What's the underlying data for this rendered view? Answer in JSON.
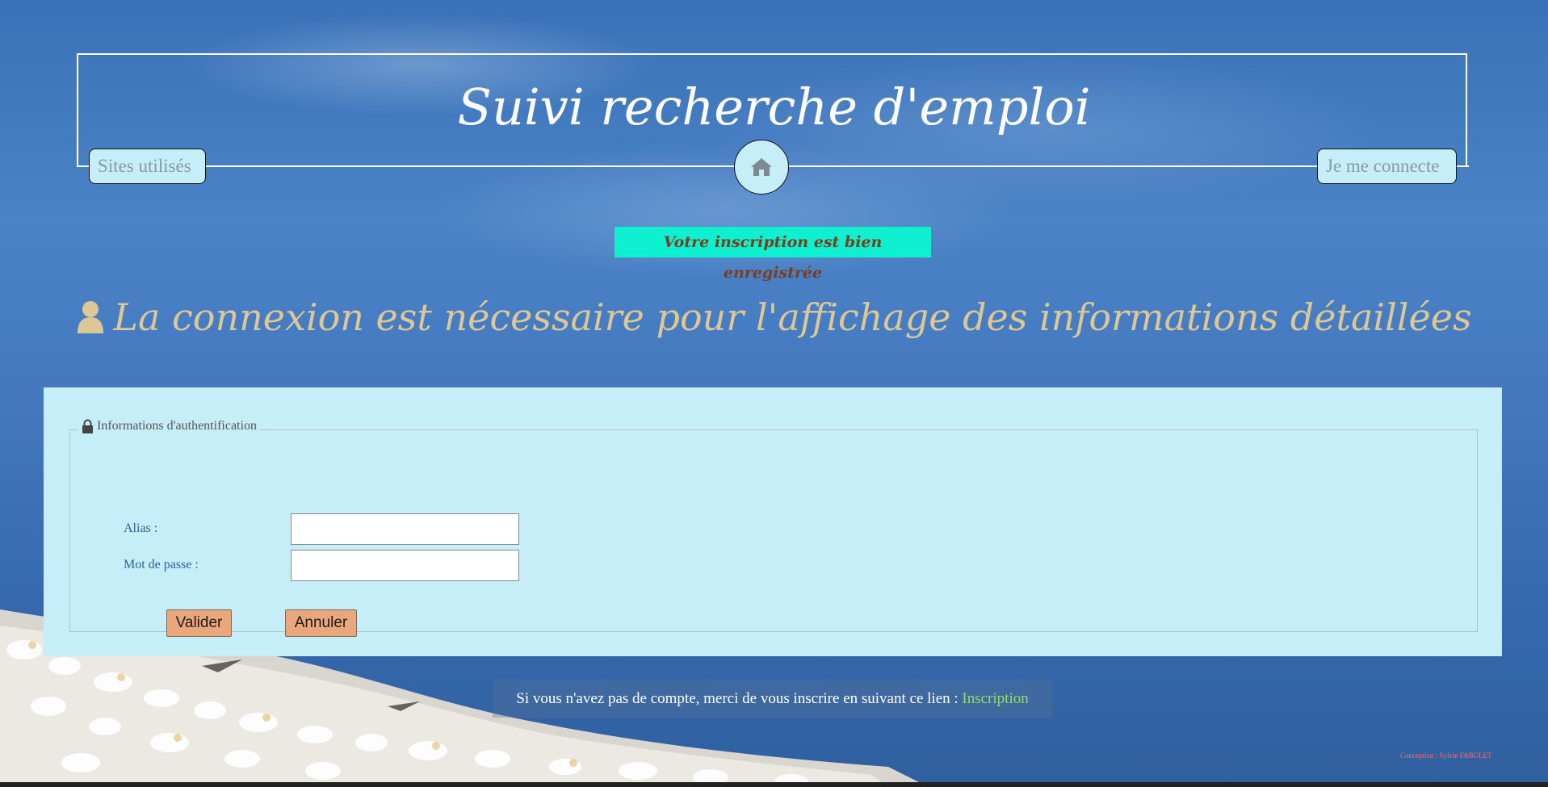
{
  "header": {
    "title": "Suivi recherche d'emploi",
    "nav_sites_label": "Sites utilisés",
    "nav_connect_label": "Je me connecte",
    "home_icon": "home-icon"
  },
  "notice": {
    "success_message": "Votre inscription est bien enregistrée"
  },
  "login_heading": {
    "icon": "user-icon",
    "text": "La connexion est nécessaire pour l'affichage des informations détaillées"
  },
  "auth_form": {
    "legend_icon": "lock-icon",
    "legend": "Informations d'authentification",
    "alias_label": "Alias :",
    "alias_value": "",
    "password_label": "Mot de passe :",
    "password_value": "",
    "submit_label": "Valider",
    "cancel_label": "Annuler"
  },
  "signup": {
    "prompt": "Si vous n'avez pas de compte, merci de vous inscrire en suivant ce lien : ",
    "link_label": "Inscription"
  },
  "footer": {
    "credit": "Conception : Sylvie FABULET"
  },
  "colors": {
    "panel_bg": "#c5eef8",
    "success_bg": "#0ef0d0",
    "heading_gold": "#ddc795",
    "button_orange": "#e9a77b",
    "link_green": "#8fe05d",
    "credit_red": "#ff6a74"
  }
}
